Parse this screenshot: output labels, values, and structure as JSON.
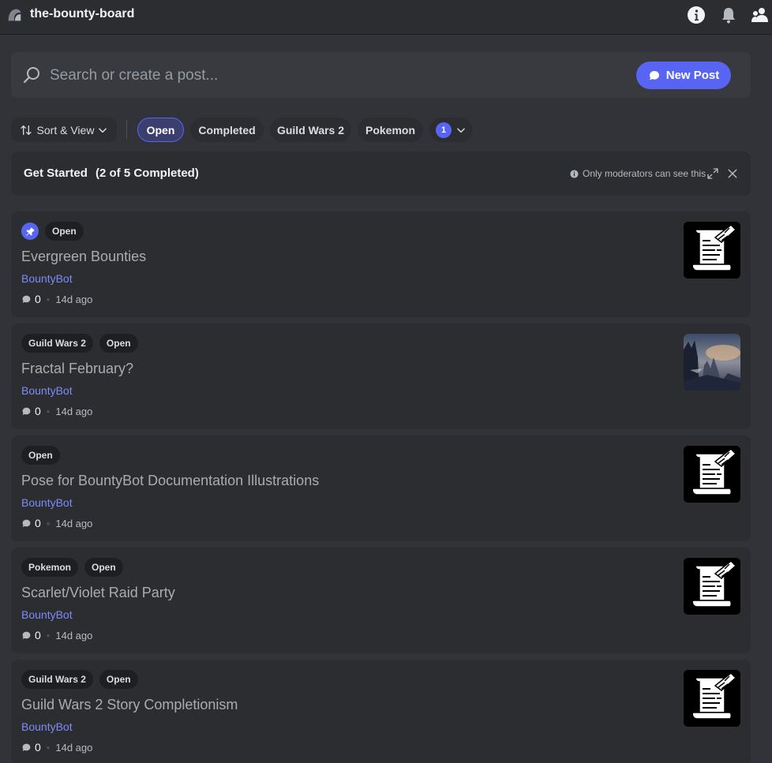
{
  "header": {
    "channel_name": "the-bounty-board",
    "icons": [
      "forum-icon",
      "info-icon",
      "bell-icon",
      "members-icon"
    ]
  },
  "search": {
    "placeholder": "Search or create a post...",
    "new_post_label": "New Post"
  },
  "filters": {
    "sort_label": "Sort & View",
    "tags": [
      "Open",
      "Completed",
      "Guild Wars 2",
      "Pokemon"
    ],
    "active_tag": "Open",
    "selected_count": "1"
  },
  "get_started": {
    "title": "Get Started",
    "progress": "(2 of 5 Completed)",
    "note": "Only moderators can see this"
  },
  "posts": [
    {
      "pinned": true,
      "tags": [
        "Open"
      ],
      "title": "Evergreen Bounties",
      "author": "BountyBot",
      "comments": "0",
      "time": "14d ago",
      "thumb": "scroll"
    },
    {
      "pinned": false,
      "tags": [
        "Guild Wars 2",
        "Open"
      ],
      "title": "Fractal February?",
      "author": "BountyBot",
      "comments": "0",
      "time": "14d ago",
      "thumb": "landscape"
    },
    {
      "pinned": false,
      "tags": [
        "Open"
      ],
      "title": "Pose for BountyBot Documentation Illustrations",
      "author": "BountyBot",
      "comments": "0",
      "time": "14d ago",
      "thumb": "scroll"
    },
    {
      "pinned": false,
      "tags": [
        "Pokemon",
        "Open"
      ],
      "title": "Scarlet/Violet Raid Party",
      "author": "BountyBot",
      "comments": "0",
      "time": "14d ago",
      "thumb": "scroll"
    },
    {
      "pinned": false,
      "tags": [
        "Guild Wars 2",
        "Open"
      ],
      "title": "Guild Wars 2 Story Completionism",
      "author": "BountyBot",
      "comments": "0",
      "time": "14d ago",
      "thumb": "scroll"
    }
  ],
  "colors": {
    "accent": "#5865f2",
    "background": "#313338",
    "card": "#2b2d31",
    "author": "#7e8cf8"
  }
}
